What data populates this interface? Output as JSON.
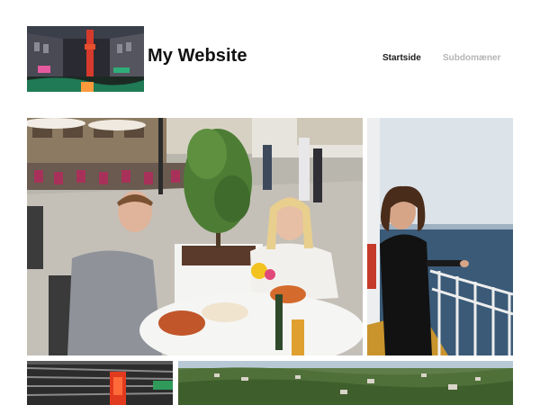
{
  "site": {
    "title": "My Website"
  },
  "nav": {
    "items": [
      {
        "label": "Startside",
        "active": true
      },
      {
        "label": "Subdomæner",
        "active": false
      }
    ]
  },
  "gallery": {
    "images": [
      {
        "description": "Two people seated at an outdoor restaurant table on a plaza"
      },
      {
        "description": "Person with curly hair standing at a ship railing overlooking the sea"
      },
      {
        "description": "Dark interior with a red illuminated column"
      },
      {
        "description": "Aerial view of a green hillside town"
      }
    ]
  },
  "colors": {
    "title": "#111111",
    "nav_active": "#1a1a1a",
    "nav_inactive": "#b5b5b5",
    "background": "#ffffff"
  }
}
